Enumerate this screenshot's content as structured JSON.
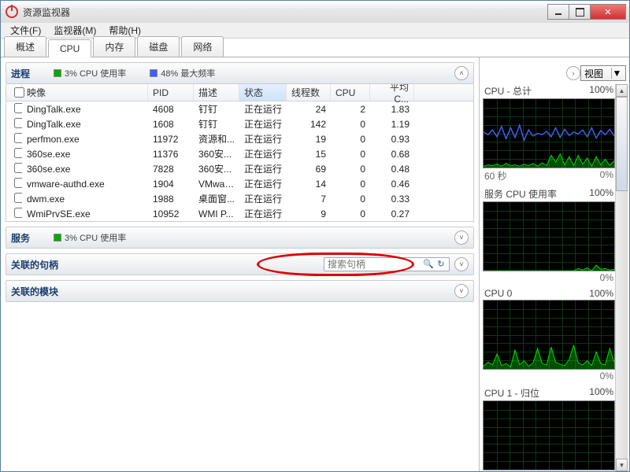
{
  "window": {
    "title": "资源监视器"
  },
  "menu": {
    "file": "文件(F)",
    "monitor": "监视器(M)",
    "help": "帮助(H)"
  },
  "tabs": {
    "overview": "概述",
    "cpu": "CPU",
    "memory": "内存",
    "disk": "磁盘",
    "network": "网络"
  },
  "sections": {
    "processes": {
      "title": "进程",
      "stat1": "3% CPU 使用率",
      "stat2": "48% 最大频率",
      "cols": {
        "image": "映像",
        "pid": "PID",
        "desc": "描述",
        "status": "状态",
        "threads": "线程数",
        "cpu": "CPU",
        "avg": "平均 C..."
      },
      "rows": [
        {
          "img": "DingTalk.exe",
          "pid": "4608",
          "desc": "钉钉",
          "status": "正在运行",
          "threads": "24",
          "cpu": "2",
          "avg": "1.83"
        },
        {
          "img": "DingTalk.exe",
          "pid": "1608",
          "desc": "钉钉",
          "status": "正在运行",
          "threads": "142",
          "cpu": "0",
          "avg": "1.19"
        },
        {
          "img": "perfmon.exe",
          "pid": "11972",
          "desc": "资源和...",
          "status": "正在运行",
          "threads": "19",
          "cpu": "0",
          "avg": "0.93"
        },
        {
          "img": "360se.exe",
          "pid": "11376",
          "desc": "360安...",
          "status": "正在运行",
          "threads": "15",
          "cpu": "0",
          "avg": "0.68"
        },
        {
          "img": "360se.exe",
          "pid": "7828",
          "desc": "360安...",
          "status": "正在运行",
          "threads": "69",
          "cpu": "0",
          "avg": "0.48"
        },
        {
          "img": "vmware-authd.exe",
          "pid": "1904",
          "desc": "VMwar...",
          "status": "正在运行",
          "threads": "14",
          "cpu": "0",
          "avg": "0.46"
        },
        {
          "img": "dwm.exe",
          "pid": "1988",
          "desc": "桌面窗...",
          "status": "正在运行",
          "threads": "7",
          "cpu": "0",
          "avg": "0.33"
        },
        {
          "img": "WmiPrvSE.exe",
          "pid": "10952",
          "desc": "WMI P...",
          "status": "正在运行",
          "threads": "9",
          "cpu": "0",
          "avg": "0.27"
        }
      ]
    },
    "services": {
      "title": "服务",
      "stat1": "3% CPU 使用率"
    },
    "handles": {
      "title": "关联的句柄",
      "placeholder": "搜索句柄"
    },
    "modules": {
      "title": "关联的模块"
    }
  },
  "right": {
    "view": "视图",
    "charts": {
      "total": {
        "label": "CPU - 总计",
        "pct": "100%",
        "foot_l": "60 秒",
        "foot_r": "0%"
      },
      "service": {
        "label": "服务 CPU 使用率",
        "pct": "100%",
        "foot_l": "",
        "foot_r": "0%"
      },
      "cpu0": {
        "label": "CPU 0",
        "pct": "100%",
        "foot_l": "",
        "foot_r": "0%"
      },
      "cpu1": {
        "label": "CPU 1 - 归位",
        "pct": "100%"
      }
    }
  },
  "chart_data": [
    {
      "type": "line",
      "title": "CPU - 总计",
      "ylim": [
        0,
        100
      ],
      "x_seconds": 60,
      "series": [
        {
          "name": "max_freq",
          "color": "#4060ff",
          "values": [
            52,
            48,
            55,
            45,
            60,
            42,
            58,
            44,
            62,
            40,
            55,
            46,
            50,
            48,
            53,
            45,
            58,
            44,
            56,
            47,
            52,
            49,
            55,
            45,
            58,
            43,
            54,
            48,
            56,
            46
          ]
        },
        {
          "name": "cpu_usage",
          "color": "#00e000",
          "values": [
            2,
            4,
            3,
            5,
            2,
            6,
            3,
            4,
            2,
            5,
            3,
            6,
            2,
            7,
            3,
            18,
            8,
            20,
            4,
            16,
            3,
            18,
            5,
            14,
            2,
            16,
            4,
            12,
            3,
            10
          ]
        }
      ]
    },
    {
      "type": "line",
      "title": "服务 CPU 使用率",
      "ylim": [
        0,
        100
      ],
      "x_seconds": 60,
      "series": [
        {
          "name": "service_cpu",
          "color": "#00e000",
          "values": [
            0,
            0,
            0,
            0,
            0,
            0,
            0,
            0,
            0,
            0,
            0,
            0,
            0,
            0,
            0,
            0,
            0,
            0,
            0,
            0,
            0,
            3,
            1,
            4,
            0,
            8,
            2,
            3,
            1,
            2
          ]
        }
      ]
    },
    {
      "type": "line",
      "title": "CPU 0",
      "ylim": [
        0,
        100
      ],
      "x_seconds": 60,
      "series": [
        {
          "name": "cpu0",
          "color": "#00e000",
          "values": [
            4,
            10,
            6,
            22,
            5,
            8,
            3,
            28,
            6,
            12,
            4,
            9,
            30,
            8,
            6,
            32,
            10,
            7,
            5,
            14,
            35,
            9,
            6,
            12,
            5,
            25,
            8,
            6,
            30,
            10
          ]
        }
      ]
    },
    {
      "type": "line",
      "title": "CPU 1 - 归位",
      "ylim": [
        0,
        100
      ],
      "x_seconds": 60,
      "series": [
        {
          "name": "cpu1",
          "color": "#00e000",
          "values": []
        }
      ]
    }
  ]
}
